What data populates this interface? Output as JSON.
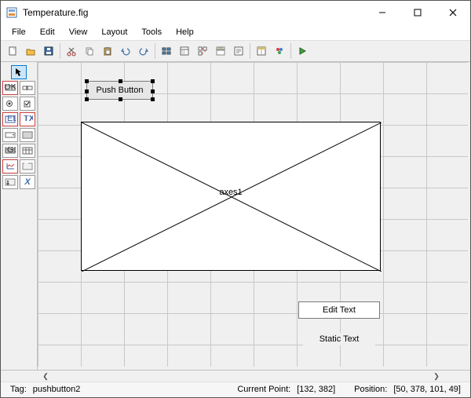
{
  "window": {
    "title": "Temperature.fig"
  },
  "menu": [
    "File",
    "Edit",
    "View",
    "Layout",
    "Tools",
    "Help"
  ],
  "toolbar_icons": [
    "new",
    "open",
    "save",
    "cut",
    "copy",
    "paste",
    "undo",
    "redo",
    "align",
    "distribute",
    "m-editor",
    "tab-order",
    "property",
    "object-browser",
    "toolbar-editor",
    "menu-editor",
    "run"
  ],
  "palette": [
    [
      "select"
    ],
    [
      "push-button",
      "slider"
    ],
    [
      "radio-button",
      "checkbox"
    ],
    [
      "edit-text",
      "static-text"
    ],
    [
      "popup-menu",
      "listbox"
    ],
    [
      "toggle-button",
      "table"
    ],
    [
      "axes",
      "panel"
    ],
    [
      "button-group",
      "activex"
    ]
  ],
  "components": {
    "pushbutton": {
      "label": "Push Button"
    },
    "axes": {
      "label": "axes1"
    },
    "edittext": {
      "label": "Edit Text"
    },
    "statictext": {
      "label": "Static Text"
    }
  },
  "status": {
    "tag_label": "Tag:",
    "tag_value": "pushbutton2",
    "current_point_label": "Current Point:",
    "current_point_value": "[132, 382]",
    "position_label": "Position:",
    "position_value": "[50, 378, 101, 49]"
  }
}
